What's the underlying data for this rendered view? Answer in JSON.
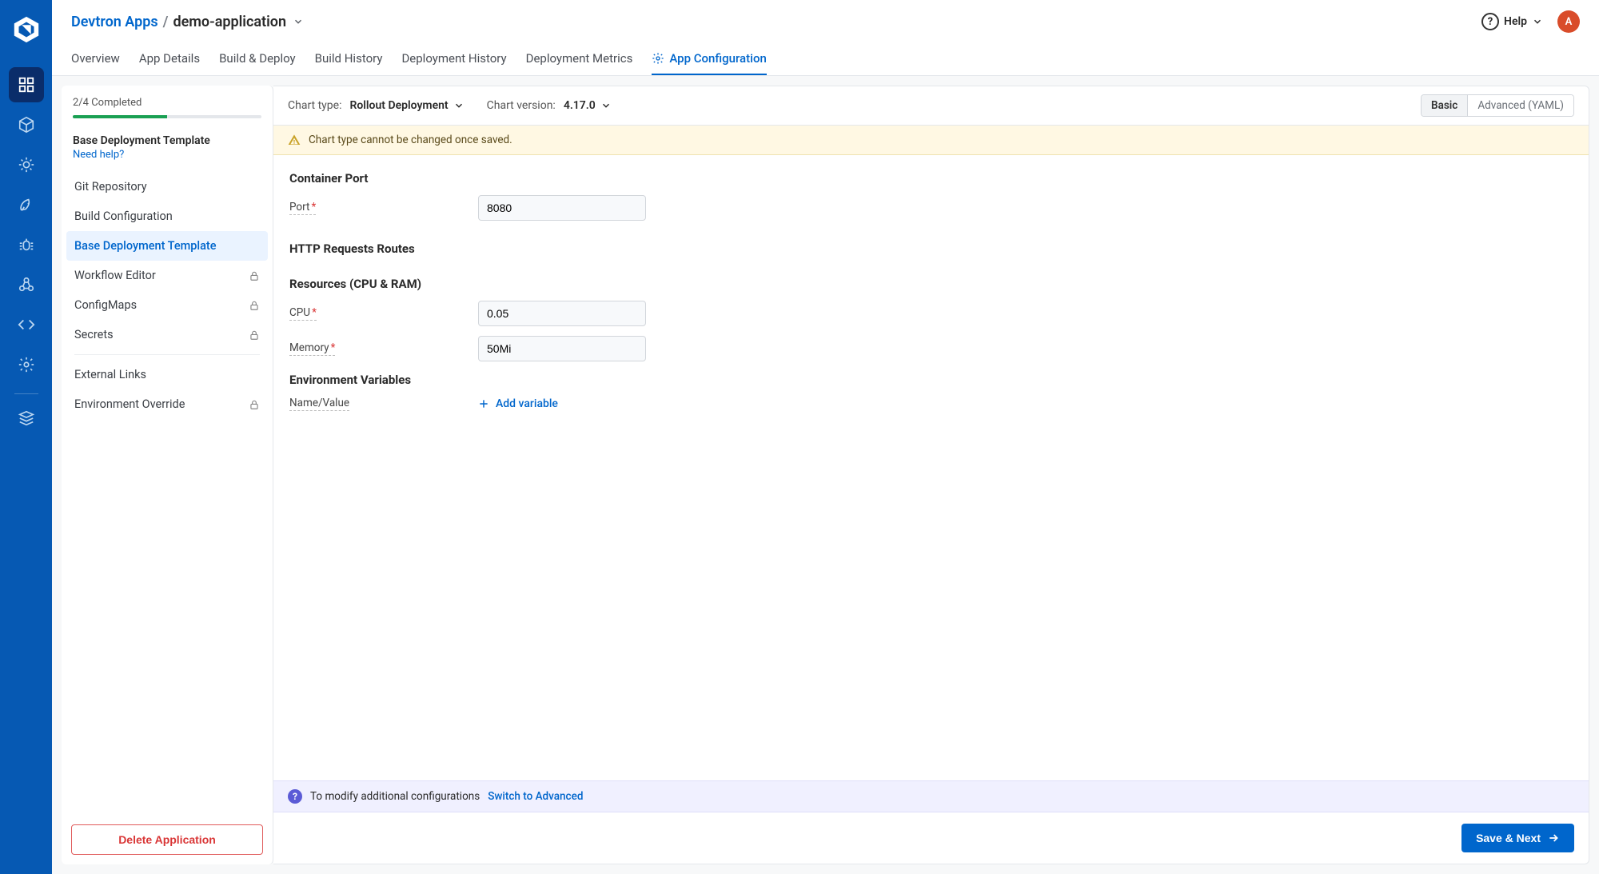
{
  "breadcrumb": {
    "root": "Devtron Apps",
    "sep": "/",
    "leaf": "demo-application"
  },
  "header": {
    "help_label": "Help",
    "avatar_initial": "A"
  },
  "tabs": [
    {
      "label": "Overview"
    },
    {
      "label": "App Details"
    },
    {
      "label": "Build & Deploy"
    },
    {
      "label": "Build History"
    },
    {
      "label": "Deployment History"
    },
    {
      "label": "Deployment Metrics"
    },
    {
      "label": "App Configuration",
      "active": true,
      "icon": "gear"
    }
  ],
  "sidebar": {
    "progress_text": "2/4 Completed",
    "progress_pct": 50,
    "section_title": "Base Deployment Template",
    "help_link": "Need help?",
    "items": [
      {
        "label": "Git Repository"
      },
      {
        "label": "Build Configuration"
      },
      {
        "label": "Base Deployment Template",
        "active": true
      },
      {
        "label": "Workflow Editor",
        "locked": true
      },
      {
        "label": "ConfigMaps",
        "locked": true
      },
      {
        "label": "Secrets",
        "locked": true
      }
    ],
    "extra": [
      {
        "label": "External Links"
      },
      {
        "label": "Environment Override",
        "locked": true
      }
    ],
    "delete_label": "Delete Application"
  },
  "toolbar": {
    "chart_type_label": "Chart type:",
    "chart_type_value": "Rollout Deployment",
    "chart_version_label": "Chart version:",
    "chart_version_value": "4.17.0",
    "mode_basic": "Basic",
    "mode_advanced": "Advanced (YAML)"
  },
  "warning": {
    "text": "Chart type cannot be changed once saved."
  },
  "form": {
    "section_container_port": "Container Port",
    "port_label": "Port",
    "port_value": "8080",
    "section_http": "HTTP Requests Routes",
    "section_resources": "Resources (CPU & RAM)",
    "cpu_label": "CPU",
    "cpu_value": "0.05",
    "memory_label": "Memory",
    "memory_value": "50Mi",
    "section_env": "Environment Variables",
    "name_value_label": "Name/Value",
    "add_variable_label": "Add variable"
  },
  "info": {
    "text": "To modify additional configurations",
    "link": "Switch to Advanced"
  },
  "footer": {
    "save_label": "Save & Next"
  }
}
